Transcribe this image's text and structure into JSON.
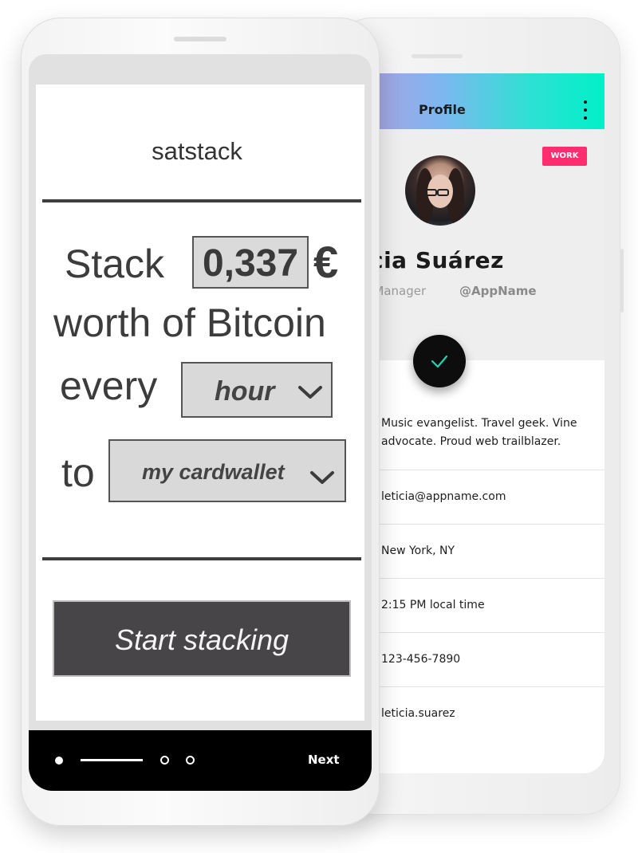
{
  "back_app": {
    "header": {
      "title": "Profile",
      "menu_icon": "more-vert-icon"
    },
    "badge": "WORK",
    "name": "ticia Suárez",
    "role": "uct Manager",
    "handle": "@AppName",
    "fab_icon": "check-icon",
    "bio": "Music evangelist. Travel geek. Vine advocate. Proud web trailblazer.",
    "info": [
      "leticia@appname.com",
      "New York, NY",
      "2:15 PM local time",
      "123-456-7890",
      "leticia.suarez"
    ],
    "colors": {
      "header_gradient": [
        "#b39ddb",
        "#00f0c8"
      ],
      "badge": "#ff2d6f",
      "check": "#21d4b4"
    }
  },
  "front_app": {
    "title": "satstack",
    "stack_label": "Stack",
    "amount": "0,337",
    "currency": "€",
    "worth_label": "worth of Bitcoin",
    "every_label": "every",
    "interval_select": {
      "selected": "hour"
    },
    "to_label": "to",
    "wallet_select": {
      "selected": "my cardwallet"
    },
    "cta_label": "Start stacking",
    "pager": {
      "next_label": "Next",
      "current_page": 1,
      "total_pages": 3
    },
    "colors": {
      "cta_bg": "#474547",
      "nav_bg": "#000000"
    }
  }
}
